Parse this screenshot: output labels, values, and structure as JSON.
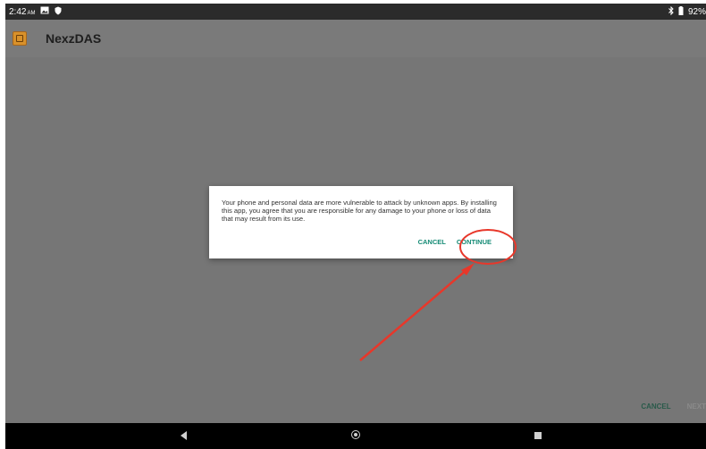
{
  "status_bar": {
    "time": "2:42",
    "ampm": "AM",
    "battery": "92%"
  },
  "app_bar": {
    "title": "NexzDAS"
  },
  "dialog": {
    "message": "Your phone and personal data are more vulnerable to attack by unknown apps. By installing this app, you agree that you are responsible for any damage to your phone or loss of data that may result from its use.",
    "cancel_label": "CANCEL",
    "continue_label": "CONTINUE"
  },
  "bottom_actions": {
    "cancel_label": "CANCEL",
    "next_label": "NEXT"
  },
  "colors": {
    "accent": "#138a74",
    "annotation": "#e8372a"
  },
  "icons": [
    "image-icon",
    "shield-icon",
    "bluetooth-icon",
    "battery-icon",
    "app-icon",
    "back-icon",
    "home-icon",
    "recents-icon"
  ]
}
